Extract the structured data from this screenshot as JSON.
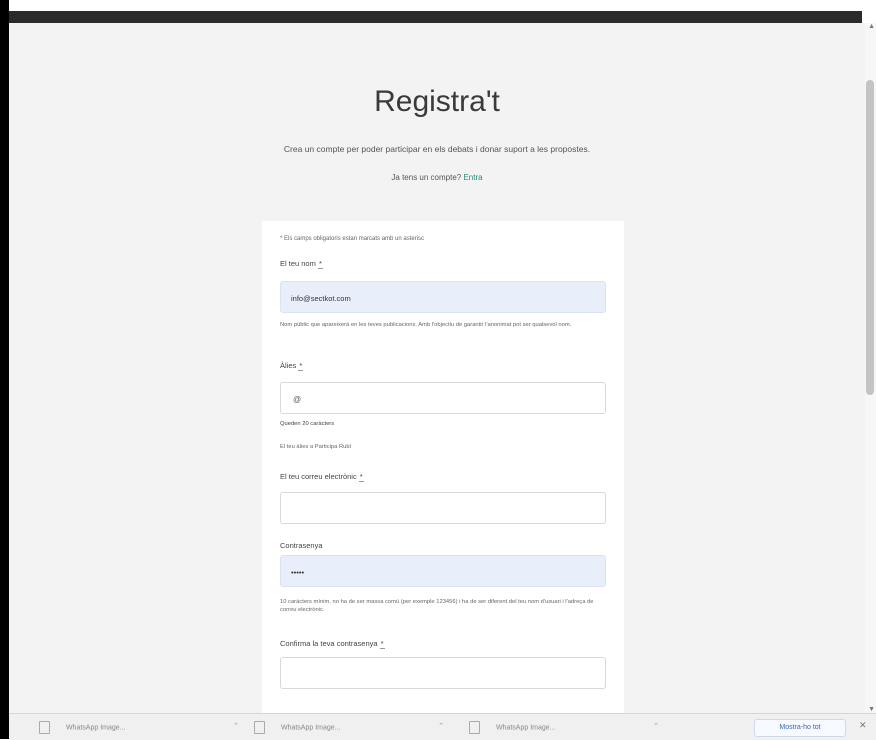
{
  "header": {
    "title": "Registra't",
    "subtitle": "Crea un compte per poder participar en els debats i donar suport a les propostes.",
    "signin_prompt": "Ja tens un compte?",
    "signin_link": "Entra"
  },
  "form": {
    "required_note": "* Els camps obligatoris estan marcats amb un asterisc",
    "name": {
      "label": "El teu nom",
      "required_mark": "*",
      "value": "info@sectkot.com",
      "help": "Nom públic que apareixerà en les teves publicacions. Amb l'objectiu de garantir l'anonimat pot ser qualsevol nom."
    },
    "alias": {
      "label": "Àlies",
      "required_mark": "*",
      "prefix": "@",
      "chars_left": "Queden 20 caràcters",
      "help": "El teu àlies a Participa Rubí"
    },
    "email": {
      "label": "El teu correu electrònic",
      "required_mark": "*"
    },
    "password": {
      "label": "Contrasenya",
      "value": "•••••",
      "help": "10 caràcters mínim, no ha de ser massa comú (per exemple 123456) i ha de ser diferent del teu nom d'usuari i l'adreça de correu electrònic."
    },
    "password_confirm": {
      "label": "Confirma la teva contrasenya",
      "required_mark": "*"
    }
  },
  "download_bar": {
    "items": [
      "WhatsApp Image...",
      "WhatsApp Image...",
      "WhatsApp Image..."
    ],
    "show_all": "Mostra-ho tot",
    "close": "✕"
  }
}
